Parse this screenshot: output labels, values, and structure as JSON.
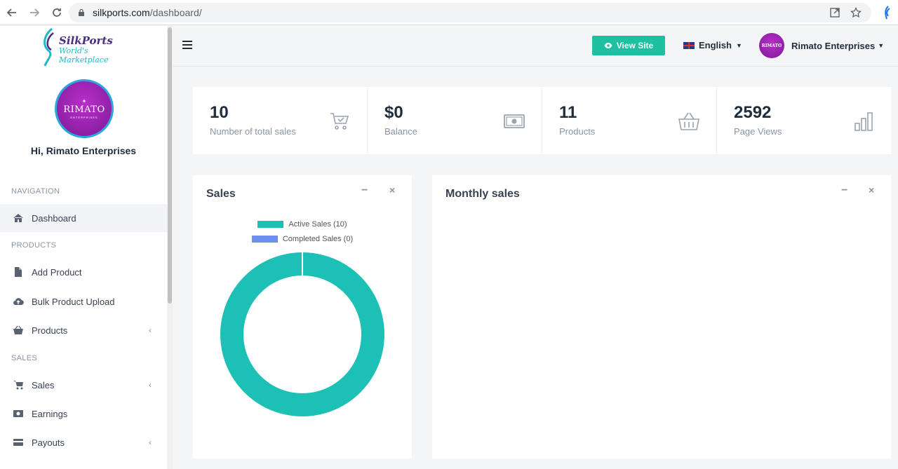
{
  "browser": {
    "url_host": "silkports.com",
    "url_path": "/dashboard/"
  },
  "brand": {
    "name": "SilkPorts",
    "tagline": "World's Marketplace",
    "avatar_text": "RIMATO",
    "avatar_sub": "ENTERPRISES"
  },
  "sidebar": {
    "greeting": "Hi, Rimato Enterprises",
    "sections": {
      "navigation": "NAVIGATION",
      "products": "PRODUCTS",
      "sales": "SALES"
    },
    "items": [
      {
        "label": "Dashboard",
        "icon": "home-icon"
      },
      {
        "label": "Add Product",
        "icon": "file-icon"
      },
      {
        "label": "Bulk Product Upload",
        "icon": "cloud-upload-icon"
      },
      {
        "label": "Products",
        "icon": "basket-icon"
      },
      {
        "label": "Sales",
        "icon": "cart-icon"
      },
      {
        "label": "Earnings",
        "icon": "money-icon"
      },
      {
        "label": "Payouts",
        "icon": "card-icon"
      }
    ]
  },
  "header": {
    "view_site": "View Site",
    "language": "English",
    "user": "Rimato Enterprises"
  },
  "stats": [
    {
      "value": "10",
      "label": "Number of total sales",
      "icon": "cart-check-icon"
    },
    {
      "value": "$0",
      "label": "Balance",
      "icon": "money-icon"
    },
    {
      "value": "11",
      "label": "Products",
      "icon": "basket-icon"
    },
    {
      "value": "2592",
      "label": "Page Views",
      "icon": "bar-chart-icon"
    }
  ],
  "panels": {
    "sales_title": "Sales",
    "monthly_title": "Monthly sales",
    "minimize": "−",
    "close": "×"
  },
  "chart_data": {
    "type": "pie",
    "categories": [
      "Active Sales (10)",
      "Completed Sales (0)"
    ],
    "values": [
      10,
      0
    ],
    "colors": [
      "#1dc0b4",
      "#6e8ff0"
    ],
    "donut": true,
    "legend": "top"
  }
}
